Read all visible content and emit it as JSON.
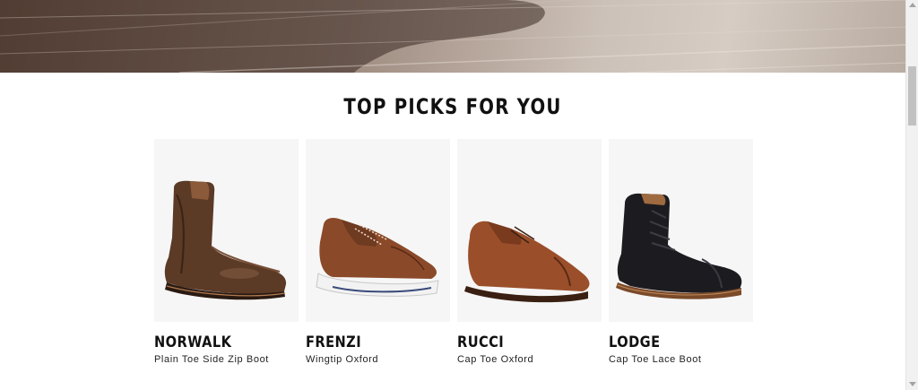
{
  "section": {
    "title": "TOP PICKS FOR YOU"
  },
  "products": [
    {
      "name": "NORWALK",
      "description": "Plain Toe Side Zip Boot",
      "image": "brown-side-zip-boot"
    },
    {
      "name": "FRENZI",
      "description": "Wingtip Oxford",
      "image": "brown-wingtip-oxford-white-sole"
    },
    {
      "name": "RUCCI",
      "description": "Cap Toe Oxford",
      "image": "brown-cap-toe-oxford"
    },
    {
      "name": "LODGE",
      "description": "Cap Toe Lace Boot",
      "image": "black-cap-toe-lace-boot"
    }
  ],
  "colors": {
    "text": "#111111",
    "card_background": "#f6f6f6",
    "page_background": "#ffffff"
  }
}
